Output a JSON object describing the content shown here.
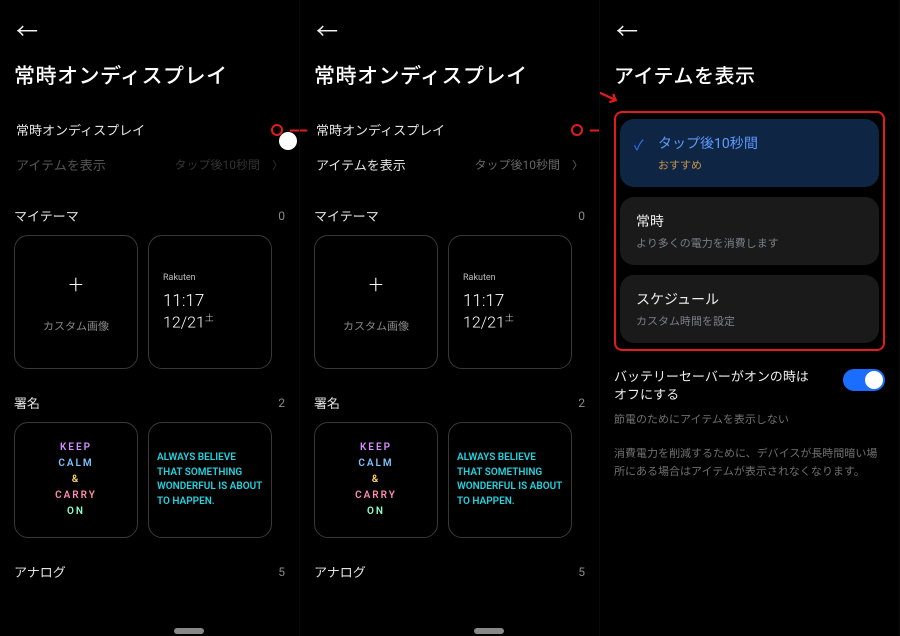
{
  "panel1": {
    "title": "常時オンディスプレイ",
    "toggle_label": "常時オンディスプレイ",
    "toggle_on": false,
    "items_label": "アイテムを表示",
    "items_value": "タップ後10秒間",
    "section_themes": "マイテーマ",
    "section_themes_count": "0",
    "tile_custom": "カスタム画像",
    "clock_brand": "Rakuten",
    "clock_time": "11:17",
    "clock_date_mm": "12",
    "clock_date_dd": "21",
    "clock_date_dow": "土",
    "section_sig": "署名",
    "section_sig_count": "2",
    "keep_lines": [
      "KEEP",
      "CALM",
      "&",
      "CARRY",
      "ON"
    ],
    "always_text": "ALWAYS BELIEVE THAT SOMETHING WONDERFUL IS ABOUT TO HAPPEN.",
    "section_analog": "アナログ",
    "section_analog_count": "5"
  },
  "panel2": {
    "title": "常時オンディスプレイ",
    "toggle_label": "常時オンディスプレイ",
    "toggle_on": true,
    "items_label": "アイテムを表示",
    "items_value": "タップ後10秒間",
    "section_themes": "マイテーマ",
    "section_themes_count": "0",
    "tile_custom": "カスタム画像",
    "clock_brand": "Rakuten",
    "clock_time": "11:17",
    "clock_date_mm": "12",
    "clock_date_dd": "21",
    "clock_date_dow": "土",
    "section_sig": "署名",
    "section_sig_count": "2",
    "keep_lines": [
      "KEEP",
      "CALM",
      "&",
      "CARRY",
      "ON"
    ],
    "always_text": "ALWAYS BELIEVE THAT SOMETHING WONDERFUL IS ABOUT TO HAPPEN.",
    "section_analog": "アナログ",
    "section_analog_count": "5"
  },
  "panel3": {
    "title": "アイテムを表示",
    "opts": [
      {
        "main": "タップ後10秒間",
        "sub": "おすすめ",
        "selected": true
      },
      {
        "main": "常時",
        "sub": "より多くの電力を消費します",
        "selected": false
      },
      {
        "main": "スケジュール",
        "sub": "カスタム時間を設定",
        "selected": false
      }
    ],
    "battery_main": "バッテリーセーバーがオンの時はオフにする",
    "battery_sub": "節電のためにアイテムを表示しない",
    "battery_on": true,
    "note": "消費電力を削減するために、デバイスが長時間暗い場所にある場合はアイテムが表示されなくなります。"
  }
}
